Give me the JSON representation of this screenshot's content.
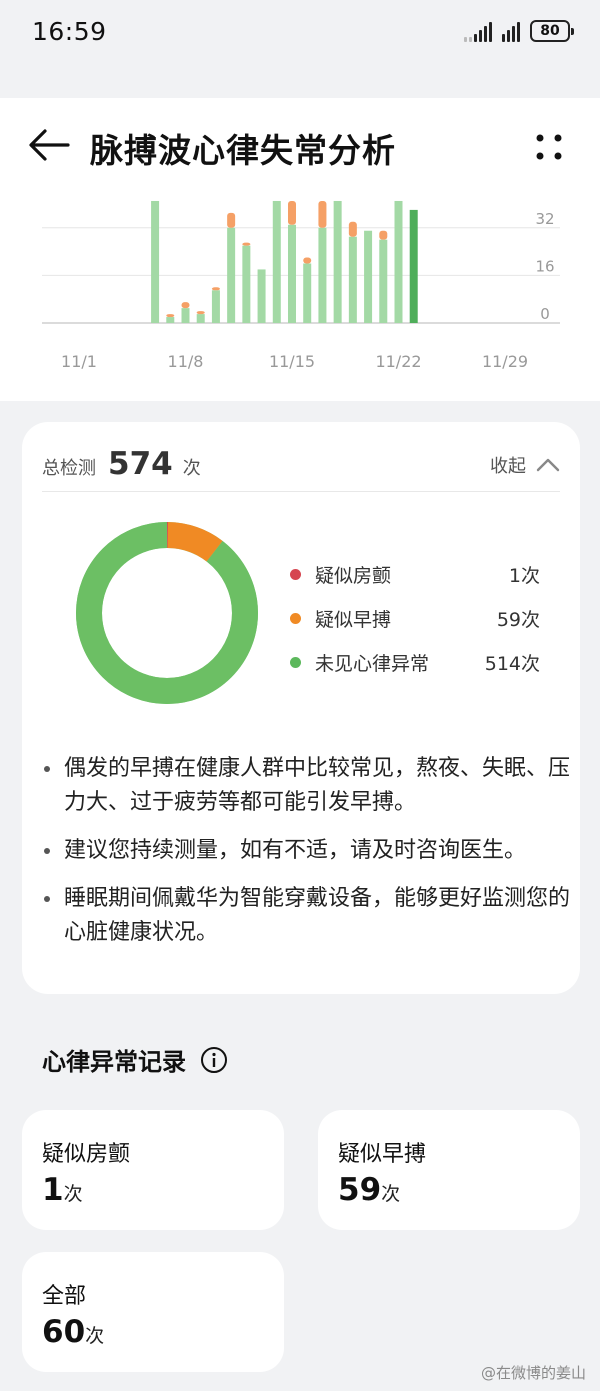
{
  "status_bar": {
    "time": "16:59",
    "battery": "80"
  },
  "header": {
    "title": "脉搏波心律失常分析"
  },
  "chart_data": {
    "type": "bar",
    "x_ticks": [
      "11/1",
      "11/8",
      "11/15",
      "11/22",
      "11/29"
    ],
    "y_ticks": [
      "32",
      "16",
      "0"
    ],
    "ylim": [
      0,
      42
    ],
    "colors": {
      "normal": "#a3d9a5",
      "premature": "#f5a066",
      "selected": "#4fae5a"
    },
    "series": [
      {
        "name": "未见心律异常",
        "values": [
          {
            "x": "11/6",
            "y": 41
          },
          {
            "x": "11/7",
            "y": 2
          },
          {
            "x": "11/8",
            "y": 5
          },
          {
            "x": "11/9",
            "y": 3
          },
          {
            "x": "11/10",
            "y": 11
          },
          {
            "x": "11/11",
            "y": 32
          },
          {
            "x": "11/12",
            "y": 26
          },
          {
            "x": "11/13",
            "y": 18
          },
          {
            "x": "11/14",
            "y": 41
          },
          {
            "x": "11/15",
            "y": 33
          },
          {
            "x": "11/16",
            "y": 20
          },
          {
            "x": "11/17",
            "y": 32
          },
          {
            "x": "11/18",
            "y": 41
          },
          {
            "x": "11/19",
            "y": 29
          },
          {
            "x": "11/20",
            "y": 31
          },
          {
            "x": "11/21",
            "y": 28
          },
          {
            "x": "11/22",
            "y": 41
          },
          {
            "x": "11/23",
            "y": 38
          }
        ]
      },
      {
        "name": "疑似早搏",
        "values": [
          {
            "x": "11/7",
            "y": 1
          },
          {
            "x": "11/8",
            "y": 2
          },
          {
            "x": "11/9",
            "y": 1
          },
          {
            "x": "11/10",
            "y": 1
          },
          {
            "x": "11/11",
            "y": 5
          },
          {
            "x": "11/12",
            "y": 1
          },
          {
            "x": "11/15",
            "y": 8
          },
          {
            "x": "11/16",
            "y": 2
          },
          {
            "x": "11/17",
            "y": 9
          },
          {
            "x": "11/19",
            "y": 5
          },
          {
            "x": "11/21",
            "y": 3
          }
        ]
      }
    ],
    "selected_x": "11/23"
  },
  "summary": {
    "label": "总检测",
    "count": "574",
    "unit": "次",
    "collapse_label": "收起",
    "donut": [
      {
        "label": "疑似房颤",
        "value": 1,
        "value_text": "1次",
        "color": "#d64550"
      },
      {
        "label": "疑似早搏",
        "value": 59,
        "value_text": "59次",
        "color": "#f08a24"
      },
      {
        "label": "未见心律异常",
        "value": 514,
        "value_text": "514次",
        "color": "#5cb85c"
      }
    ],
    "tips": [
      "偶发的早搏在健康人群中比较常见，熬夜、失眠、压力大、过于疲劳等都可能引发早搏。",
      "建议您持续测量，如有不适，请及时咨询医生。",
      "睡眠期间佩戴华为智能穿戴设备，能够更好监测您的心脏健康状况。"
    ]
  },
  "records": {
    "title": "心律异常记录",
    "cards": [
      {
        "label": "疑似房颤",
        "num": "1",
        "unit": "次"
      },
      {
        "label": "疑似早搏",
        "num": "59",
        "unit": "次"
      },
      {
        "label": "全部",
        "num": "60",
        "unit": "次"
      }
    ]
  },
  "watermark": "@在微博的姜山"
}
